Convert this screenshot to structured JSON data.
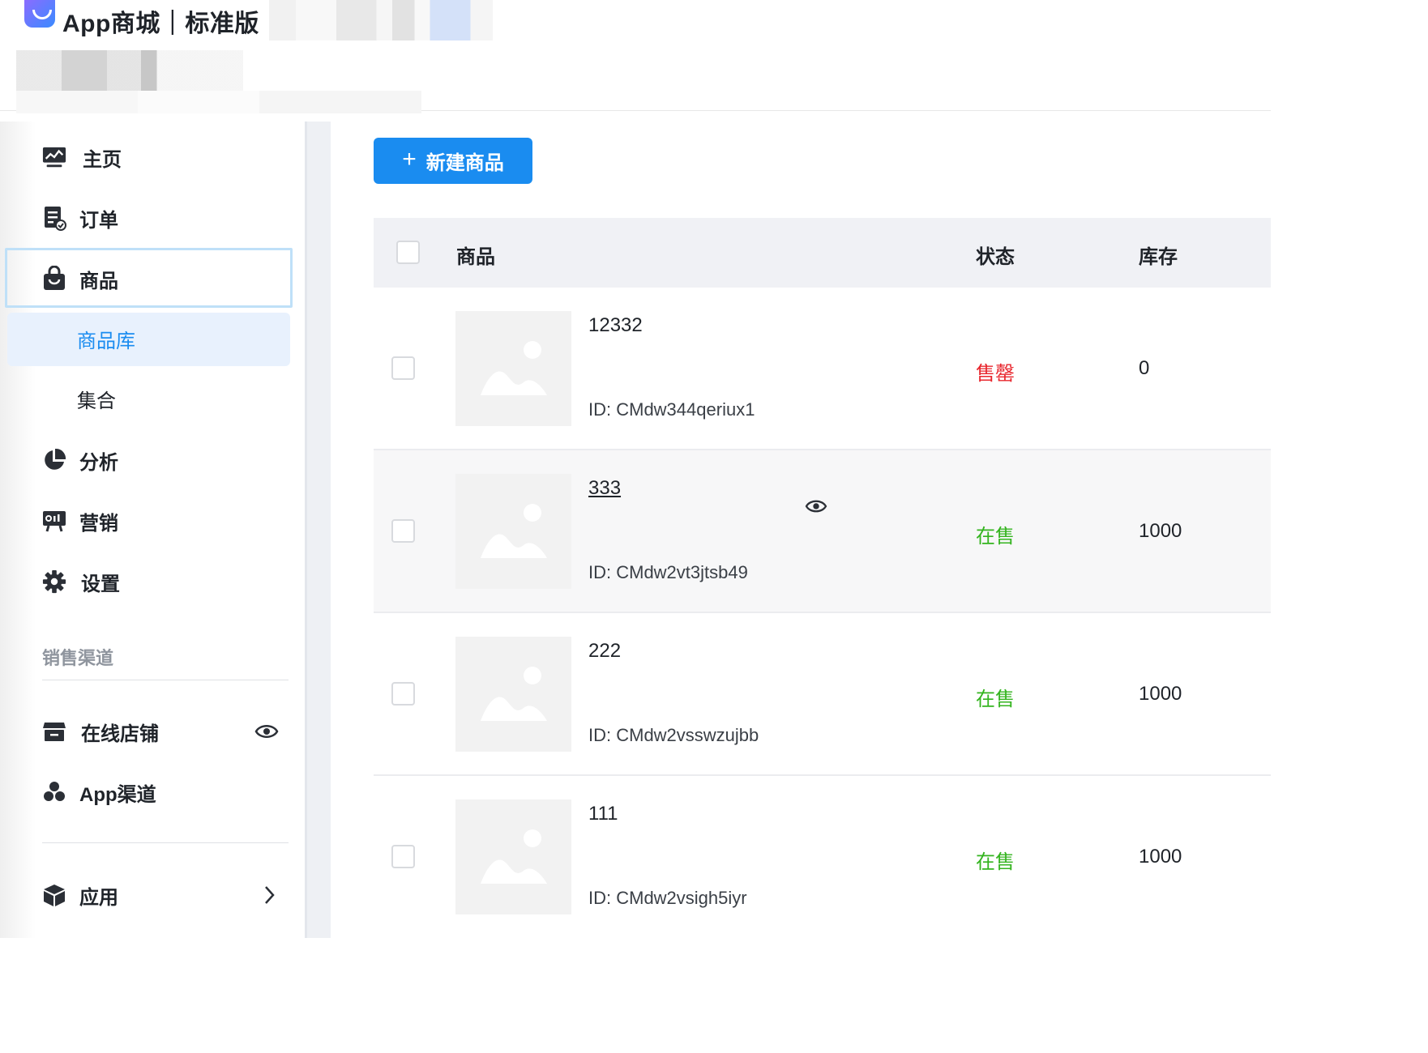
{
  "header": {
    "brand": "App商城｜标准版"
  },
  "sidebar": {
    "items": [
      {
        "label": "主页",
        "icon": "dashboard-chart-icon"
      },
      {
        "label": "订单",
        "icon": "order-document-icon"
      },
      {
        "label": "商品",
        "icon": "shopping-bag-icon",
        "active": true,
        "children": [
          {
            "label": "商品库",
            "active": true
          },
          {
            "label": "集合"
          }
        ]
      },
      {
        "label": "分析",
        "icon": "pie-chart-icon"
      },
      {
        "label": "营销",
        "icon": "marketing-board-icon"
      },
      {
        "label": "设置",
        "icon": "gear-icon"
      }
    ],
    "channels_title": "销售渠道",
    "channels": [
      {
        "label": "在线店铺",
        "icon": "storefront-icon",
        "action_icon": "eye-icon"
      },
      {
        "label": "App渠道",
        "icon": "app-cluster-icon"
      }
    ],
    "apps": {
      "label": "应用",
      "icon": "cube-icon",
      "action_icon": "chevron-right-icon"
    }
  },
  "toolbar": {
    "new_product_label": "新建商品"
  },
  "table": {
    "columns": [
      "商品",
      "状态",
      "库存"
    ],
    "rows": [
      {
        "name": "12332",
        "id_text": "ID: CMdw344qeriux1",
        "status": "售罄",
        "status_color": "#e8262d",
        "stock": "0"
      },
      {
        "name": "333",
        "id_text": "ID: CMdw2vt3jtsb49",
        "status": "在售",
        "status_color": "#34b41f",
        "stock": "1000",
        "hovered": true
      },
      {
        "name": "222",
        "id_text": "ID: CMdw2vsswzujbb",
        "status": "在售",
        "status_color": "#34b41f",
        "stock": "1000"
      },
      {
        "name": "111",
        "id_text": "ID: CMdw2vsigh5iyr",
        "status": "在售",
        "status_color": "#34b41f",
        "stock": "1000"
      }
    ]
  },
  "colors": {
    "primary": "#1a8cf0",
    "sold_out": "#e8262d",
    "on_sale": "#34b41f",
    "active_bg": "#e8f1fd"
  }
}
